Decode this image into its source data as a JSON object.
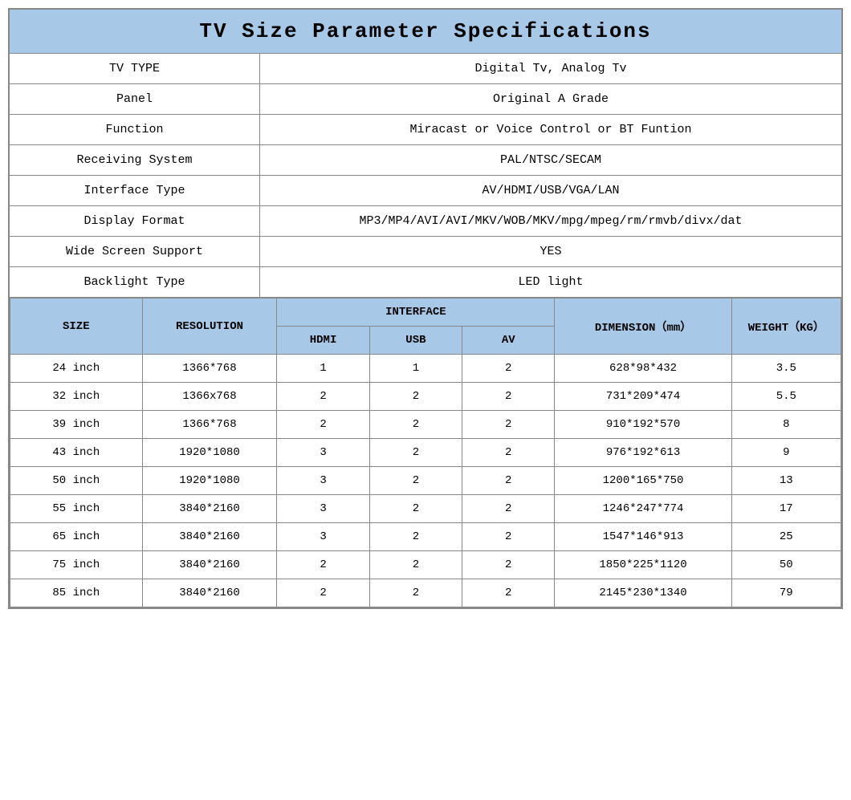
{
  "title": "TV  Size  Parameter  Specifications",
  "specs": [
    {
      "label": "TV TYPE",
      "value": "Digital Tv, Analog Tv"
    },
    {
      "label": "Panel",
      "value": "Original A Grade"
    },
    {
      "label": "Function",
      "value": "Miracast or Voice Control or BT Funtion"
    },
    {
      "label": "Receiving System",
      "value": "PAL/NTSC/SECAM"
    },
    {
      "label": "Interface Type",
      "value": "AV/HDMI/USB/VGA/LAN"
    },
    {
      "label": "Display Format",
      "value": "MP3/MP4/AVI/AVI/MKV/WOB/MKV/mpg/mpeg/rm/rmvb/divx/dat"
    },
    {
      "label": "Wide Screen Support",
      "value": "YES"
    },
    {
      "label": "Backlight Type",
      "value": "LED light"
    }
  ],
  "size_table": {
    "col_size": "SIZE",
    "col_resolution": "RESOLUTION",
    "col_interface": "INTERFACE",
    "col_hdmi": "HDMI",
    "col_usb": "USB",
    "col_av": "AV",
    "col_dimension": "DIMENSION（mm）",
    "col_weight": "WEIGHT（KG）",
    "rows": [
      {
        "size": "24 inch",
        "resolution": "1366*768",
        "hdmi": "1",
        "usb": "1",
        "av": "2",
        "dimension": "628*98*432",
        "weight": "3.5"
      },
      {
        "size": "32 inch",
        "resolution": "1366x768",
        "hdmi": "2",
        "usb": "2",
        "av": "2",
        "dimension": "731*209*474",
        "weight": "5.5"
      },
      {
        "size": "39 inch",
        "resolution": "1366*768",
        "hdmi": "2",
        "usb": "2",
        "av": "2",
        "dimension": "910*192*570",
        "weight": "8"
      },
      {
        "size": "43 inch",
        "resolution": "1920*1080",
        "hdmi": "3",
        "usb": "2",
        "av": "2",
        "dimension": "976*192*613",
        "weight": "9"
      },
      {
        "size": "50 inch",
        "resolution": "1920*1080",
        "hdmi": "3",
        "usb": "2",
        "av": "2",
        "dimension": "1200*165*750",
        "weight": "13"
      },
      {
        "size": "55 inch",
        "resolution": "3840*2160",
        "hdmi": "3",
        "usb": "2",
        "av": "2",
        "dimension": "1246*247*774",
        "weight": "17"
      },
      {
        "size": "65 inch",
        "resolution": "3840*2160",
        "hdmi": "3",
        "usb": "2",
        "av": "2",
        "dimension": "1547*146*913",
        "weight": "25"
      },
      {
        "size": "75 inch",
        "resolution": "3840*2160",
        "hdmi": "2",
        "usb": "2",
        "av": "2",
        "dimension": "1850*225*1120",
        "weight": "50"
      },
      {
        "size": "85 inch",
        "resolution": "3840*2160",
        "hdmi": "2",
        "usb": "2",
        "av": "2",
        "dimension": "2145*230*1340",
        "weight": "79"
      }
    ]
  }
}
